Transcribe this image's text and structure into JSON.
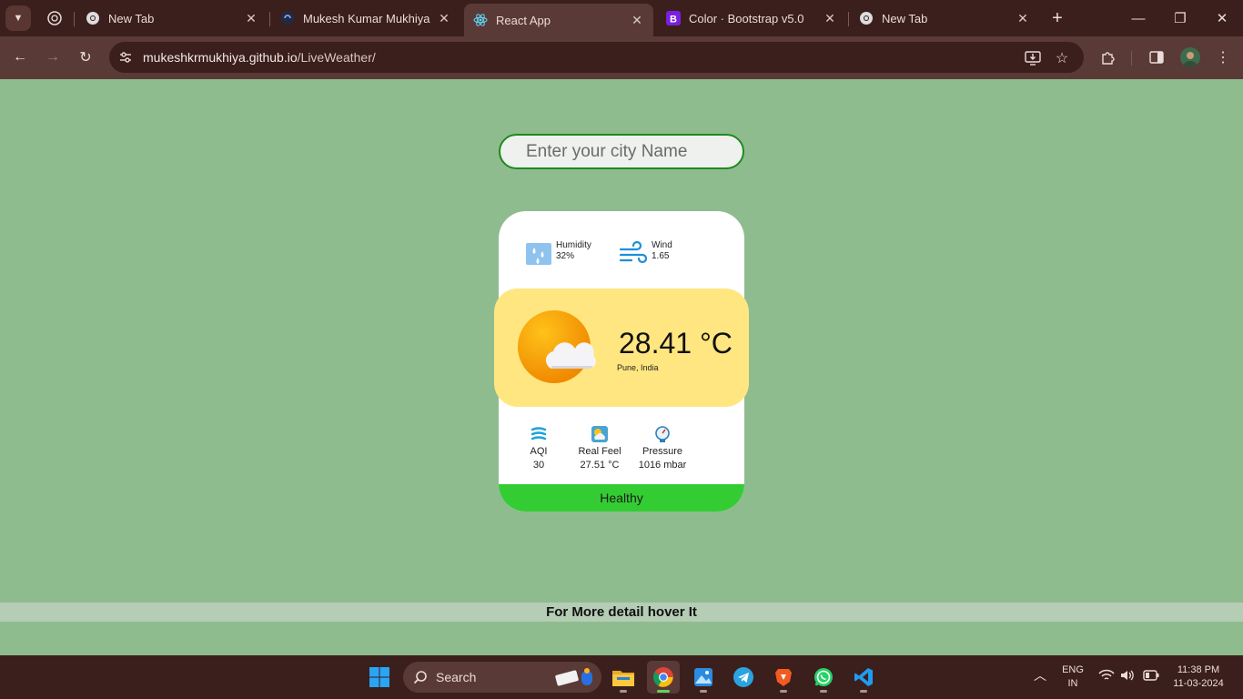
{
  "browser": {
    "tabs": [
      {
        "title": "New Tab"
      },
      {
        "title": "Mukesh Kumar Mukhiya"
      },
      {
        "title": "React App"
      },
      {
        "title": "Color · Bootstrap v5.0"
      },
      {
        "title": "New Tab"
      }
    ],
    "url": {
      "host": "mukeshkrmukhiya.github.io",
      "path": "/LiveWeather/"
    }
  },
  "page": {
    "search": {
      "placeholder": "Enter your city Name",
      "value": ""
    },
    "weather": {
      "humidity": {
        "label": "Humidity",
        "value": "32%"
      },
      "wind": {
        "label": "Wind",
        "value": "1.65"
      },
      "temperature": "28.41 °C",
      "location": "Pune, India",
      "aqi": {
        "label": "AQI",
        "value": "30"
      },
      "real_feel": {
        "label": "Real Feel",
        "value": "27.51 °C"
      },
      "pressure": {
        "label": "Pressure",
        "value": "1016 mbar"
      },
      "status": "Healthy"
    },
    "hover_hint": "For More detail hover It"
  },
  "taskbar": {
    "search_label": "Search",
    "language": {
      "line1": "ENG",
      "line2": "IN"
    },
    "clock": {
      "time": "11:38 PM",
      "date": "11-03-2024"
    }
  },
  "colors": {
    "page_bg": "#8fbc8f",
    "status_green": "#33cc33",
    "weather_panel": "#ffe680",
    "input_border": "#1e8a1e"
  }
}
